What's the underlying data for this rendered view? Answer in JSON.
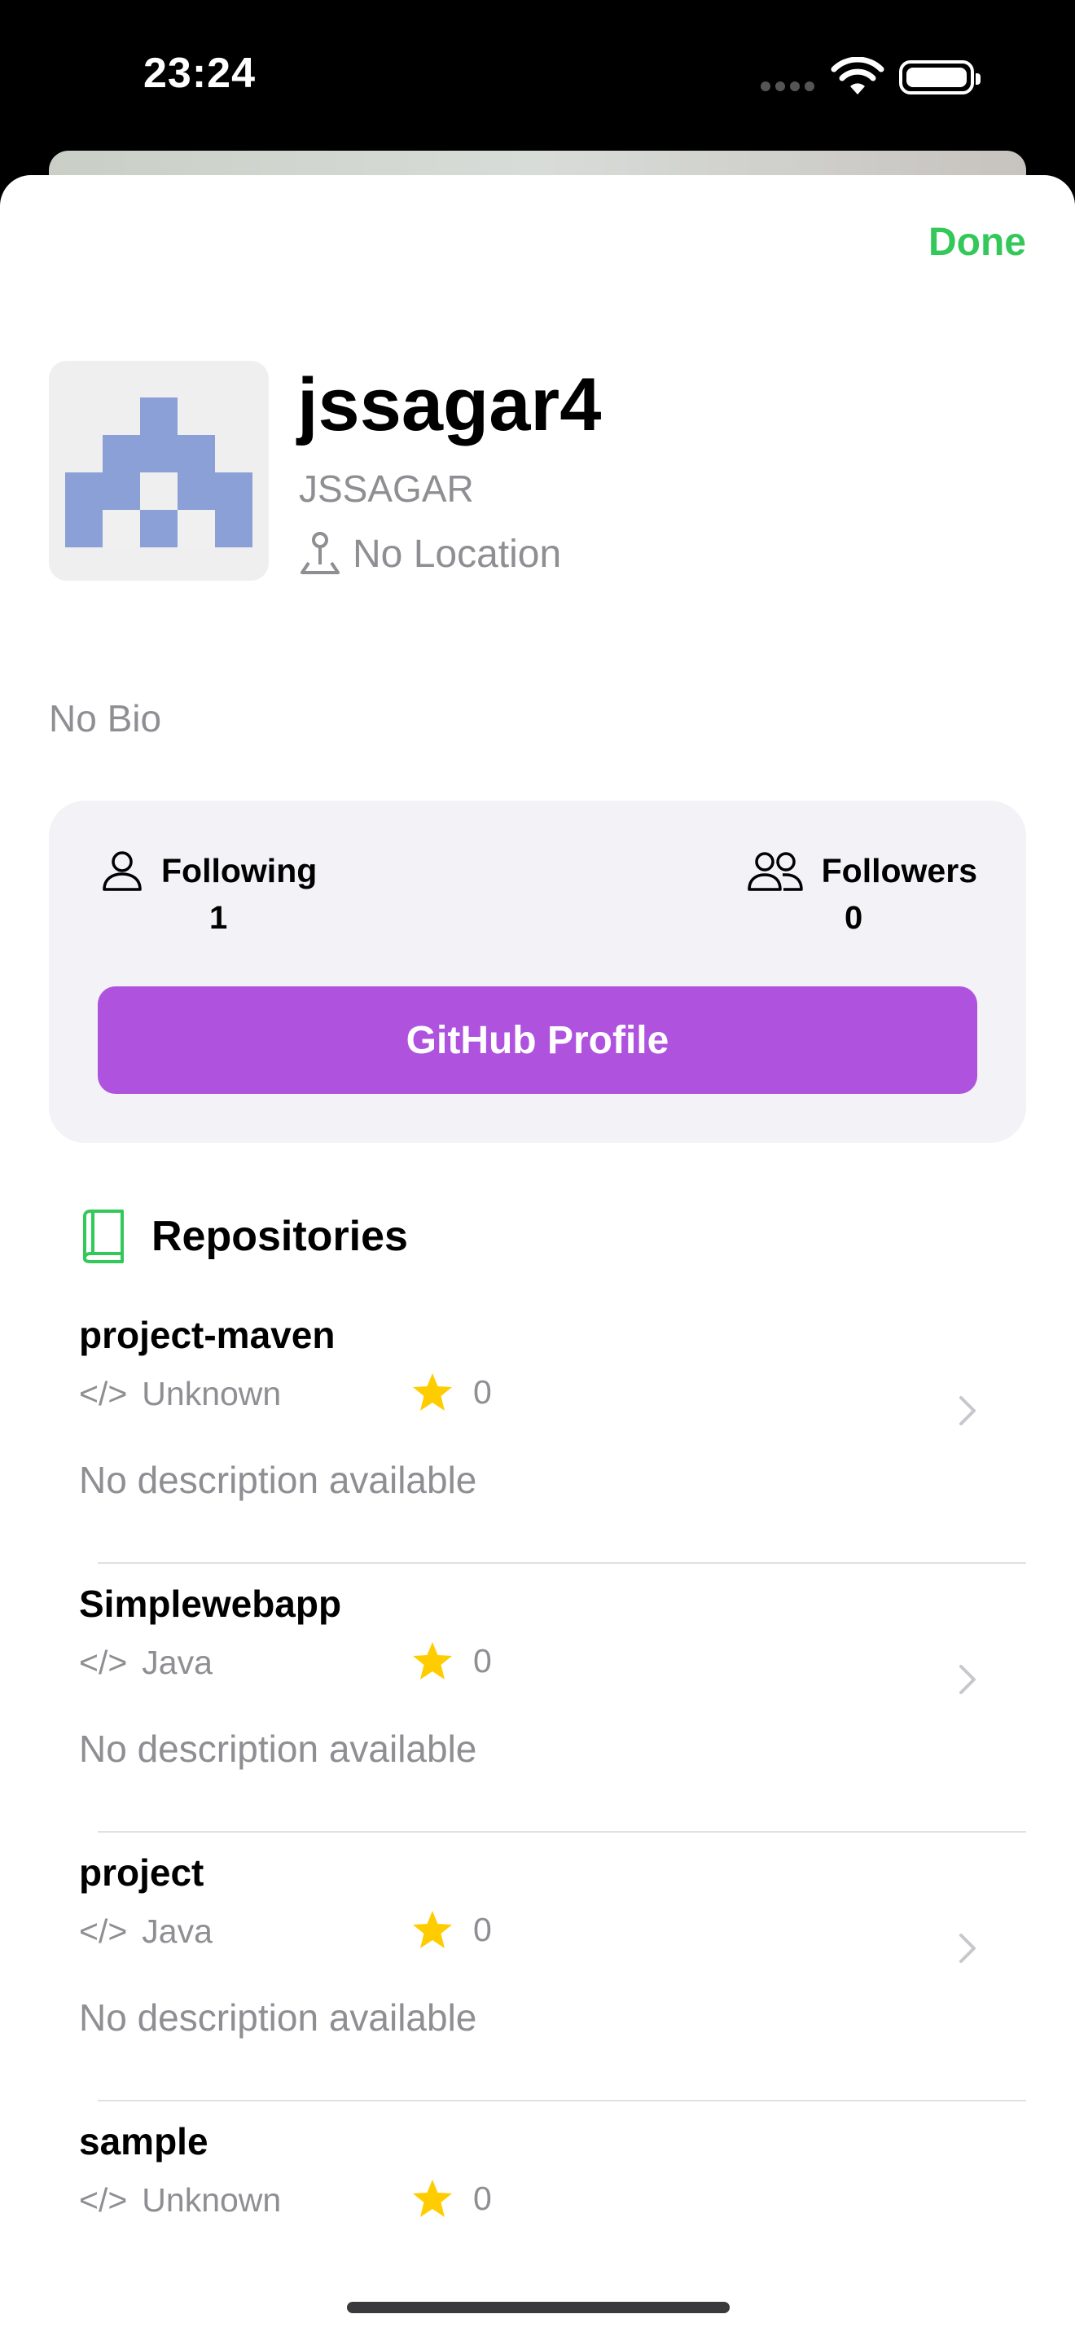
{
  "status_bar": {
    "time": "23:24"
  },
  "header": {
    "done_label": "Done"
  },
  "profile": {
    "username": "jssagar4",
    "full_name": "JSSAGAR",
    "location": "No Location",
    "bio": "No Bio",
    "avatar_color": "#8aa0d6"
  },
  "stats": {
    "following_label": "Following",
    "following_count": "1",
    "followers_label": "Followers",
    "followers_count": "0"
  },
  "github_button_label": "GitHub Profile",
  "repositories": {
    "title": "Repositories",
    "items": [
      {
        "name": "project-maven",
        "language": "Unknown",
        "stars": "0",
        "description": "No description available"
      },
      {
        "name": "Simplewebapp",
        "language": "Java",
        "stars": "0",
        "description": "No description available"
      },
      {
        "name": "project",
        "language": "Java",
        "stars": "0",
        "description": "No description available"
      },
      {
        "name": "sample",
        "language": "Unknown",
        "stars": "0",
        "description": ""
      }
    ]
  },
  "colors": {
    "accent_green": "#34c759",
    "button_purple": "#af52de",
    "star_yellow": "#ffcc00"
  }
}
